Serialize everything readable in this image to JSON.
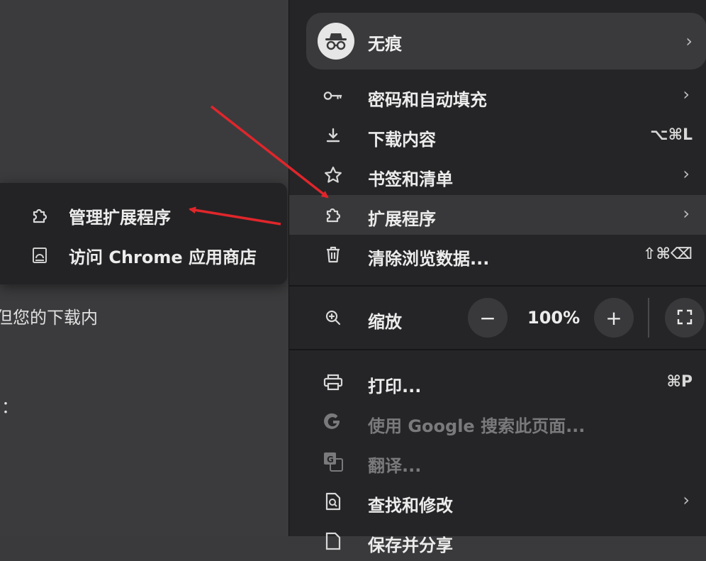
{
  "background": {
    "texts": [
      "但您的下载内",
      "："
    ]
  },
  "submenu": {
    "items": [
      {
        "label": "管理扩展程序",
        "icon": "puzzle-icon"
      },
      {
        "label": "访问 Chrome 应用商店",
        "icon": "web-store-icon"
      }
    ]
  },
  "menu": {
    "profile": {
      "label": "无痕",
      "icon": "incognito-icon",
      "chevron": "›"
    },
    "items": [
      {
        "label": "密码和自动填充",
        "icon": "key-icon",
        "chevron": "›"
      },
      {
        "label": "下载内容",
        "icon": "download-icon",
        "shortcut": "⌥⌘L"
      },
      {
        "label": "书签和清单",
        "icon": "star-icon",
        "chevron": "›"
      },
      {
        "label": "扩展程序",
        "icon": "puzzle-icon",
        "chevron": "›"
      },
      {
        "label": "清除浏览数据...",
        "icon": "trash-icon",
        "shortcut": "⇧⌘⌫"
      }
    ],
    "zoom": {
      "label": "缩放",
      "minus": "−",
      "value": "100%",
      "plus": "+"
    },
    "items2": [
      {
        "label": "打印...",
        "icon": "print-icon",
        "shortcut": "⌘P"
      },
      {
        "label": "使用 Google 搜索此页面...",
        "icon": "google-icon"
      },
      {
        "label": "翻译...",
        "icon": "translate-icon"
      },
      {
        "label": "查找和修改",
        "icon": "find-icon",
        "chevron": "›"
      },
      {
        "label": "保存并分享",
        "icon": "save-icon"
      }
    ]
  },
  "colors": {
    "menu_bg": "#252527",
    "highlight": "#38383a",
    "annotation_arrow": "#e0262b"
  }
}
